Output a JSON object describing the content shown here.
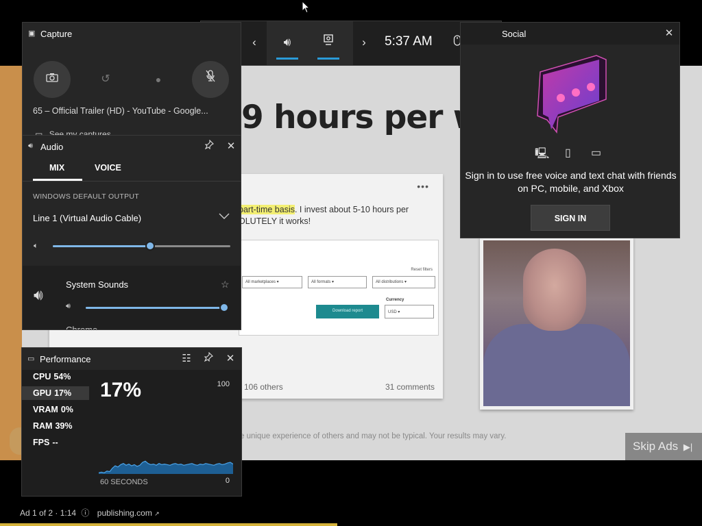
{
  "topbar": {
    "clock": "5:37 AM",
    "icons": [
      "widget-menu-icon",
      "chevron-left-icon",
      "audio-icon",
      "capture-icon",
      "chevron-right-icon",
      "mouse-icon",
      "gear-icon"
    ]
  },
  "capture": {
    "title": "Capture",
    "file_name": "65 – Official Trailer (HD) - YouTube - Google...",
    "see_captures": "See my captures"
  },
  "audio": {
    "title": "Audio",
    "tabs": [
      "MIX",
      "VOICE"
    ],
    "active_tab": "MIX",
    "output_label": "WINDOWS DEFAULT OUTPUT",
    "device": "Line 1 (Virtual Audio Cable)",
    "master_volume": 0.55,
    "apps": [
      {
        "name": "System Sounds",
        "volume": 1.0
      },
      {
        "name": "Chrome",
        "volume": null
      }
    ]
  },
  "performance": {
    "title": "Performance",
    "metrics": [
      {
        "label": "CPU",
        "value": "54%"
      },
      {
        "label": "GPU",
        "value": "17%"
      },
      {
        "label": "VRAM",
        "value": "0%"
      },
      {
        "label": "RAM",
        "value": "39%"
      },
      {
        "label": "FPS",
        "value": "--"
      }
    ],
    "selected_metric": "GPU",
    "big_value": "17%",
    "axis_max": "100",
    "axis_min": "0",
    "axis_label": "60 SECONDS",
    "series": [
      2,
      3,
      2,
      5,
      4,
      10,
      14,
      12,
      16,
      18,
      15,
      17,
      14,
      16,
      13,
      15,
      20,
      22,
      18,
      16,
      17,
      15,
      18,
      16,
      17,
      16,
      15,
      17,
      18,
      16,
      17,
      15,
      16,
      17,
      18,
      16,
      15,
      17,
      16,
      18,
      17,
      16,
      15,
      17,
      18,
      16,
      17,
      19,
      20,
      17
    ]
  },
  "social": {
    "title": "Social",
    "message": "Sign in to use free voice and text chat with friends on PC, mobile, and Xbox",
    "sign_in": "SIGN IN"
  },
  "video": {
    "headline": "9 hours per w",
    "post_text_highlight": "part-time basis",
    "post_text_1": ". I invest about 5-10 hours per",
    "post_text_2": "OLUTELY it works!",
    "screenshot": {
      "reset_filters": "Reset filters",
      "dropdowns": [
        "All marketplaces",
        "All formats",
        "All distributions"
      ],
      "download": "Download report",
      "currency_label": "Currency",
      "currency_value": "USD"
    },
    "likes": "106 others",
    "comments": "31 comments",
    "disclaimer": "e unique experience of others and may not be typical. Your results may vary.",
    "skip_ads": "Skip Ads",
    "ad_info": "Ad 1 of 2 · 1:14",
    "ad_link": "publishing.com",
    "ad_progress": 0.48
  }
}
